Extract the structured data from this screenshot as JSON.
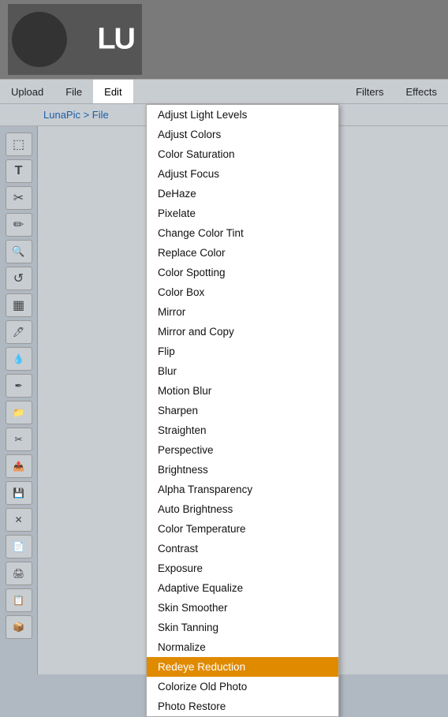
{
  "header": {
    "logo_text": "LU"
  },
  "nav": {
    "items": [
      {
        "label": "Upload",
        "id": "upload"
      },
      {
        "label": "File",
        "id": "file"
      },
      {
        "label": "Edit",
        "id": "edit"
      },
      {
        "label": "Filters",
        "id": "filters"
      },
      {
        "label": "Effects",
        "id": "effects"
      }
    ],
    "active": "edit"
  },
  "breadcrumb": {
    "text": "LunaPic > File"
  },
  "tools": [
    {
      "icon": "⬚",
      "name": "select-tool"
    },
    {
      "icon": "T",
      "name": "text-tool"
    },
    {
      "icon": "✂",
      "name": "cut-tool"
    },
    {
      "icon": "✏",
      "name": "pencil-tool"
    },
    {
      "icon": "🔍",
      "name": "zoom-tool"
    },
    {
      "icon": "↺",
      "name": "rotate-tool"
    },
    {
      "icon": "▦",
      "name": "grid-tool"
    },
    {
      "icon": "🖊",
      "name": "brush-tool"
    },
    {
      "icon": "💧",
      "name": "dropper-tool"
    },
    {
      "icon": "✒",
      "name": "pen-tool"
    },
    {
      "icon": "📁",
      "name": "folder-tool"
    },
    {
      "icon": "✂",
      "name": "crop-tool"
    },
    {
      "icon": "📤",
      "name": "export-tool"
    },
    {
      "icon": "💾",
      "name": "save-tool"
    },
    {
      "icon": "✕",
      "name": "close-tool"
    },
    {
      "icon": "📄",
      "name": "new-tool"
    },
    {
      "icon": "🖨",
      "name": "print-tool"
    },
    {
      "icon": "📋",
      "name": "copy-tool"
    },
    {
      "icon": "📦",
      "name": "layer-tool"
    }
  ],
  "dropdown": {
    "items": [
      {
        "label": "Adjust Light Levels",
        "id": "adjust-light",
        "highlighted": false
      },
      {
        "label": "Adjust Colors",
        "id": "adjust-colors",
        "highlighted": false
      },
      {
        "label": "Color Saturation",
        "id": "color-saturation",
        "highlighted": false
      },
      {
        "label": "Adjust Focus",
        "id": "adjust-focus",
        "highlighted": false
      },
      {
        "label": "DeHaze",
        "id": "dehaze",
        "highlighted": false
      },
      {
        "label": "Pixelate",
        "id": "pixelate",
        "highlighted": false
      },
      {
        "label": "Change Color Tint",
        "id": "change-color-tint",
        "highlighted": false
      },
      {
        "label": "Replace Color",
        "id": "replace-color",
        "highlighted": false
      },
      {
        "label": "Color Spotting",
        "id": "color-spotting",
        "highlighted": false
      },
      {
        "label": "Color Box",
        "id": "color-box",
        "highlighted": false
      },
      {
        "label": "Mirror",
        "id": "mirror",
        "highlighted": false
      },
      {
        "label": "Mirror and Copy",
        "id": "mirror-copy",
        "highlighted": false
      },
      {
        "label": "Flip",
        "id": "flip",
        "highlighted": false
      },
      {
        "label": "Blur",
        "id": "blur",
        "highlighted": false
      },
      {
        "label": "Motion Blur",
        "id": "motion-blur",
        "highlighted": false
      },
      {
        "label": "Sharpen",
        "id": "sharpen",
        "highlighted": false
      },
      {
        "label": "Straighten",
        "id": "straighten",
        "highlighted": false
      },
      {
        "label": "Perspective",
        "id": "perspective",
        "highlighted": false
      },
      {
        "label": "Brightness",
        "id": "brightness",
        "highlighted": false
      },
      {
        "label": "Alpha Transparency",
        "id": "alpha-transparency",
        "highlighted": false
      },
      {
        "label": "Auto Brightness",
        "id": "auto-brightness",
        "highlighted": false
      },
      {
        "label": "Color Temperature",
        "id": "color-temperature",
        "highlighted": false
      },
      {
        "label": "Contrast",
        "id": "contrast",
        "highlighted": false
      },
      {
        "label": "Exposure",
        "id": "exposure",
        "highlighted": false
      },
      {
        "label": "Adaptive Equalize",
        "id": "adaptive-equalize",
        "highlighted": false
      },
      {
        "label": "Skin Smoother",
        "id": "skin-smoother",
        "highlighted": false
      },
      {
        "label": "Skin Tanning",
        "id": "skin-tanning",
        "highlighted": false
      },
      {
        "label": "Normalize",
        "id": "normalize",
        "highlighted": false
      },
      {
        "label": "Redeye Reduction",
        "id": "redeye-reduction",
        "highlighted": true
      },
      {
        "label": "Colorize Old Photo",
        "id": "colorize-old-photo",
        "highlighted": false
      },
      {
        "label": "Photo Restore",
        "id": "photo-restore",
        "highlighted": false
      }
    ]
  }
}
